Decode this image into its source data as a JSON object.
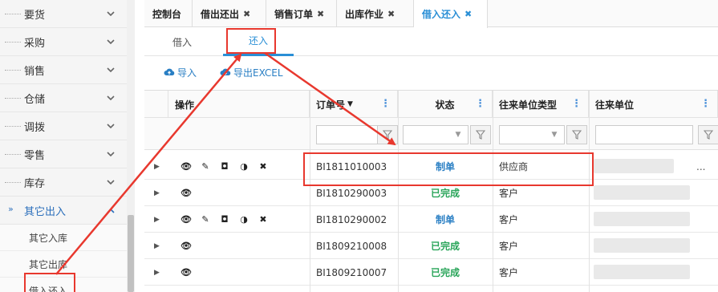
{
  "sidebar": {
    "items": [
      {
        "label": "要货"
      },
      {
        "label": "采购"
      },
      {
        "label": "销售"
      },
      {
        "label": "仓储"
      },
      {
        "label": "调拨"
      },
      {
        "label": "零售"
      },
      {
        "label": "库存"
      },
      {
        "label": "其它出入"
      }
    ],
    "children": [
      {
        "label": "其它入库"
      },
      {
        "label": "其它出库"
      },
      {
        "label": "借入还入"
      }
    ]
  },
  "tabs": [
    {
      "label": "控制台"
    },
    {
      "label": "借出还出"
    },
    {
      "label": "销售订单"
    },
    {
      "label": "出库作业"
    },
    {
      "label": "借入还入"
    }
  ],
  "subtabs": [
    {
      "label": "借入"
    },
    {
      "label": "还入"
    }
  ],
  "toolbar": {
    "import_label": "导入",
    "export_label": "导出EXCEL"
  },
  "grid": {
    "headers": {
      "ops": "操作",
      "order_no": "订单号",
      "status": "状态",
      "partner_type": "往来单位类型",
      "partner": "往来单位"
    },
    "rows": [
      {
        "order_no": "BI1811010003",
        "status": "制单",
        "status_kind": "draft",
        "partner_type": "供应商",
        "full_ops": true,
        "partner_tail": "..."
      },
      {
        "order_no": "BI1810290003",
        "status": "已完成",
        "status_kind": "done",
        "partner_type": "客户",
        "full_ops": false
      },
      {
        "order_no": "BI1810290002",
        "status": "制单",
        "status_kind": "draft",
        "partner_type": "客户",
        "full_ops": true
      },
      {
        "order_no": "BI1809210008",
        "status": "已完成",
        "status_kind": "done",
        "partner_type": "客户",
        "full_ops": false
      },
      {
        "order_no": "BI1809210007",
        "status": "已完成",
        "status_kind": "done",
        "partner_type": "客户",
        "full_ops": false
      }
    ]
  },
  "colors": {
    "accent": "#2a8fd6",
    "annotation": "#e8382e",
    "draft": "#2a7fc4",
    "done": "#2aa55a"
  }
}
